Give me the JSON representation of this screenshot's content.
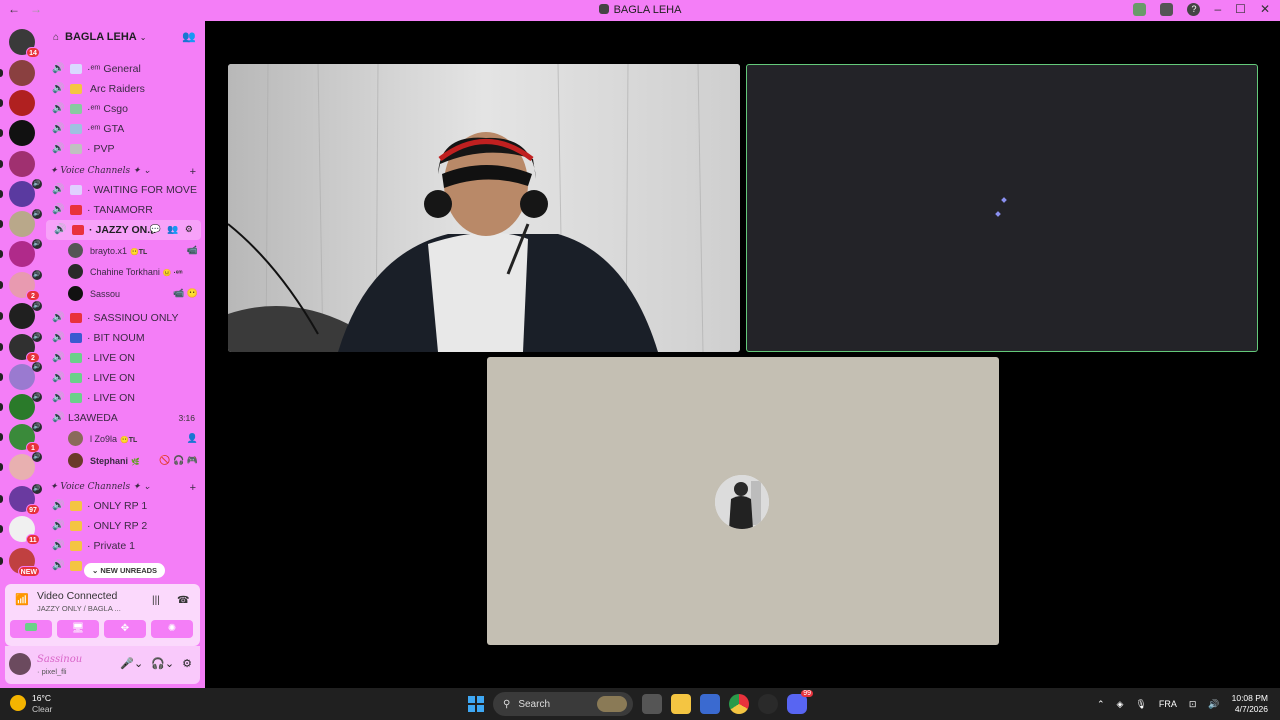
{
  "window": {
    "title": "BAGLA LEHA",
    "back": "←",
    "forward": "→"
  },
  "guilds": [
    {
      "color": "#3a3a3a",
      "badge": "14"
    },
    {
      "color": "#8a4040"
    },
    {
      "color": "#b02020"
    },
    {
      "color": "#111111"
    },
    {
      "color": "#a03070"
    },
    {
      "color": "#5a3aa0",
      "vol": true
    },
    {
      "color": "#b9a88a",
      "vol": true
    },
    {
      "color": "#b02a8a",
      "vol": true
    },
    {
      "color": "#e89ab0",
      "vol": true,
      "badge": "2"
    },
    {
      "color": "#202020",
      "vol": true
    },
    {
      "color": "#303030",
      "vol": true,
      "badge": "2"
    },
    {
      "color": "#9a7ad0",
      "vol": true
    },
    {
      "color": "#2a7a2a",
      "vol": true
    },
    {
      "color": "#3a8a3a",
      "vol": true,
      "badge": "1"
    },
    {
      "color": "#e8b0b0",
      "vol": true
    },
    {
      "color": "#6a3aa0",
      "vol": true,
      "badge": "97"
    },
    {
      "color": "#f0f0f0",
      "badge": "11"
    },
    {
      "color": "#c04040",
      "badge": "NEW"
    }
  ],
  "server": {
    "name": "BAGLA LEHA"
  },
  "channels_top": [
    {
      "name": "General",
      "prefix": "·ᵉᵐ",
      "emoji_color": "#d9d9ff"
    },
    {
      "name": "Arc Raiders",
      "prefix": "",
      "emoji_color": "#f4c542"
    },
    {
      "name": "Csgo",
      "prefix": "·ᵉᵐ",
      "emoji_color": "#88c9a1"
    },
    {
      "name": "GTA",
      "prefix": "·ᵉᵐ",
      "emoji_color": "#a0c0e0"
    },
    {
      "name": "PVP",
      "prefix": "·",
      "emoji_color": "#c0c0c0"
    }
  ],
  "category1": {
    "label": "✦ Voice Channels ✦ ⌄"
  },
  "channels_mid": [
    {
      "name": "WAITING FOR MOVE",
      "prefix": "·",
      "emoji_color": "#e0d0ff"
    },
    {
      "name": "TANAMORR",
      "prefix": "·",
      "emoji_color": "#e8323c"
    }
  ],
  "active_channel": {
    "name": "JAZZY ON...",
    "prefix": "·",
    "icons": "💬 👥 ⚙"
  },
  "voice_users_1": [
    {
      "name": "brayto.x1",
      "tag": "😶TL",
      "icon": "📹"
    },
    {
      "name": "Chahine Torkhani",
      "tag": "😐 ·ᵉᵐ",
      "icon": ""
    },
    {
      "name": "Sassou",
      "tag": "",
      "icon": "📹 😶"
    }
  ],
  "channels_mid2": [
    {
      "name": "SASSINOU ONLY",
      "prefix": "·",
      "emoji_color": "#e8323c"
    },
    {
      "name": "BIT NOUM",
      "prefix": "·",
      "emoji_color": "#3a5ad0"
    },
    {
      "name": "LIVE ON",
      "prefix": "·",
      "emoji_color": "#6ad08a"
    },
    {
      "name": "LIVE ON",
      "prefix": "·",
      "emoji_color": "#6ad08a"
    },
    {
      "name": "LIVE ON",
      "prefix": "·",
      "emoji_color": "#6ad08a"
    }
  ],
  "l3aweda": {
    "name": "L3AWEDA",
    "timer": "3:16"
  },
  "voice_users_2": [
    {
      "name": "l Zo9la",
      "tag": "😶TL",
      "icon": "👤"
    },
    {
      "name": "Stephani",
      "tag": "🌿",
      "icon": "🚫 🎧 🎮"
    }
  ],
  "category2": {
    "label": "✦ Voice Channels ✦ ⌄"
  },
  "channels_bottom": [
    {
      "name": "ONLY RP 1",
      "prefix": "·",
      "emoji_color": "#f4c542"
    },
    {
      "name": "ONLY RP 2",
      "prefix": "·",
      "emoji_color": "#f4c542"
    },
    {
      "name": "Private 1",
      "prefix": "·",
      "emoji_color": "#f4c542"
    },
    {
      "name": "",
      "prefix": "",
      "emoji_color": "#f4c542"
    }
  ],
  "new_unreads": "⌄ NEW UNREADS",
  "voice_panel": {
    "status": "Video Connected",
    "sub": "JAZZY ONLY / BAGLA ..."
  },
  "user_panel": {
    "name": "Sassinou",
    "status": "· pixel_fli"
  },
  "taskbar": {
    "temp": "16°C",
    "weather": "Clear",
    "search": "Search",
    "lang": "FRA",
    "time": "10:08 PM",
    "date": "4/7/2026",
    "discord_badge": "99"
  }
}
